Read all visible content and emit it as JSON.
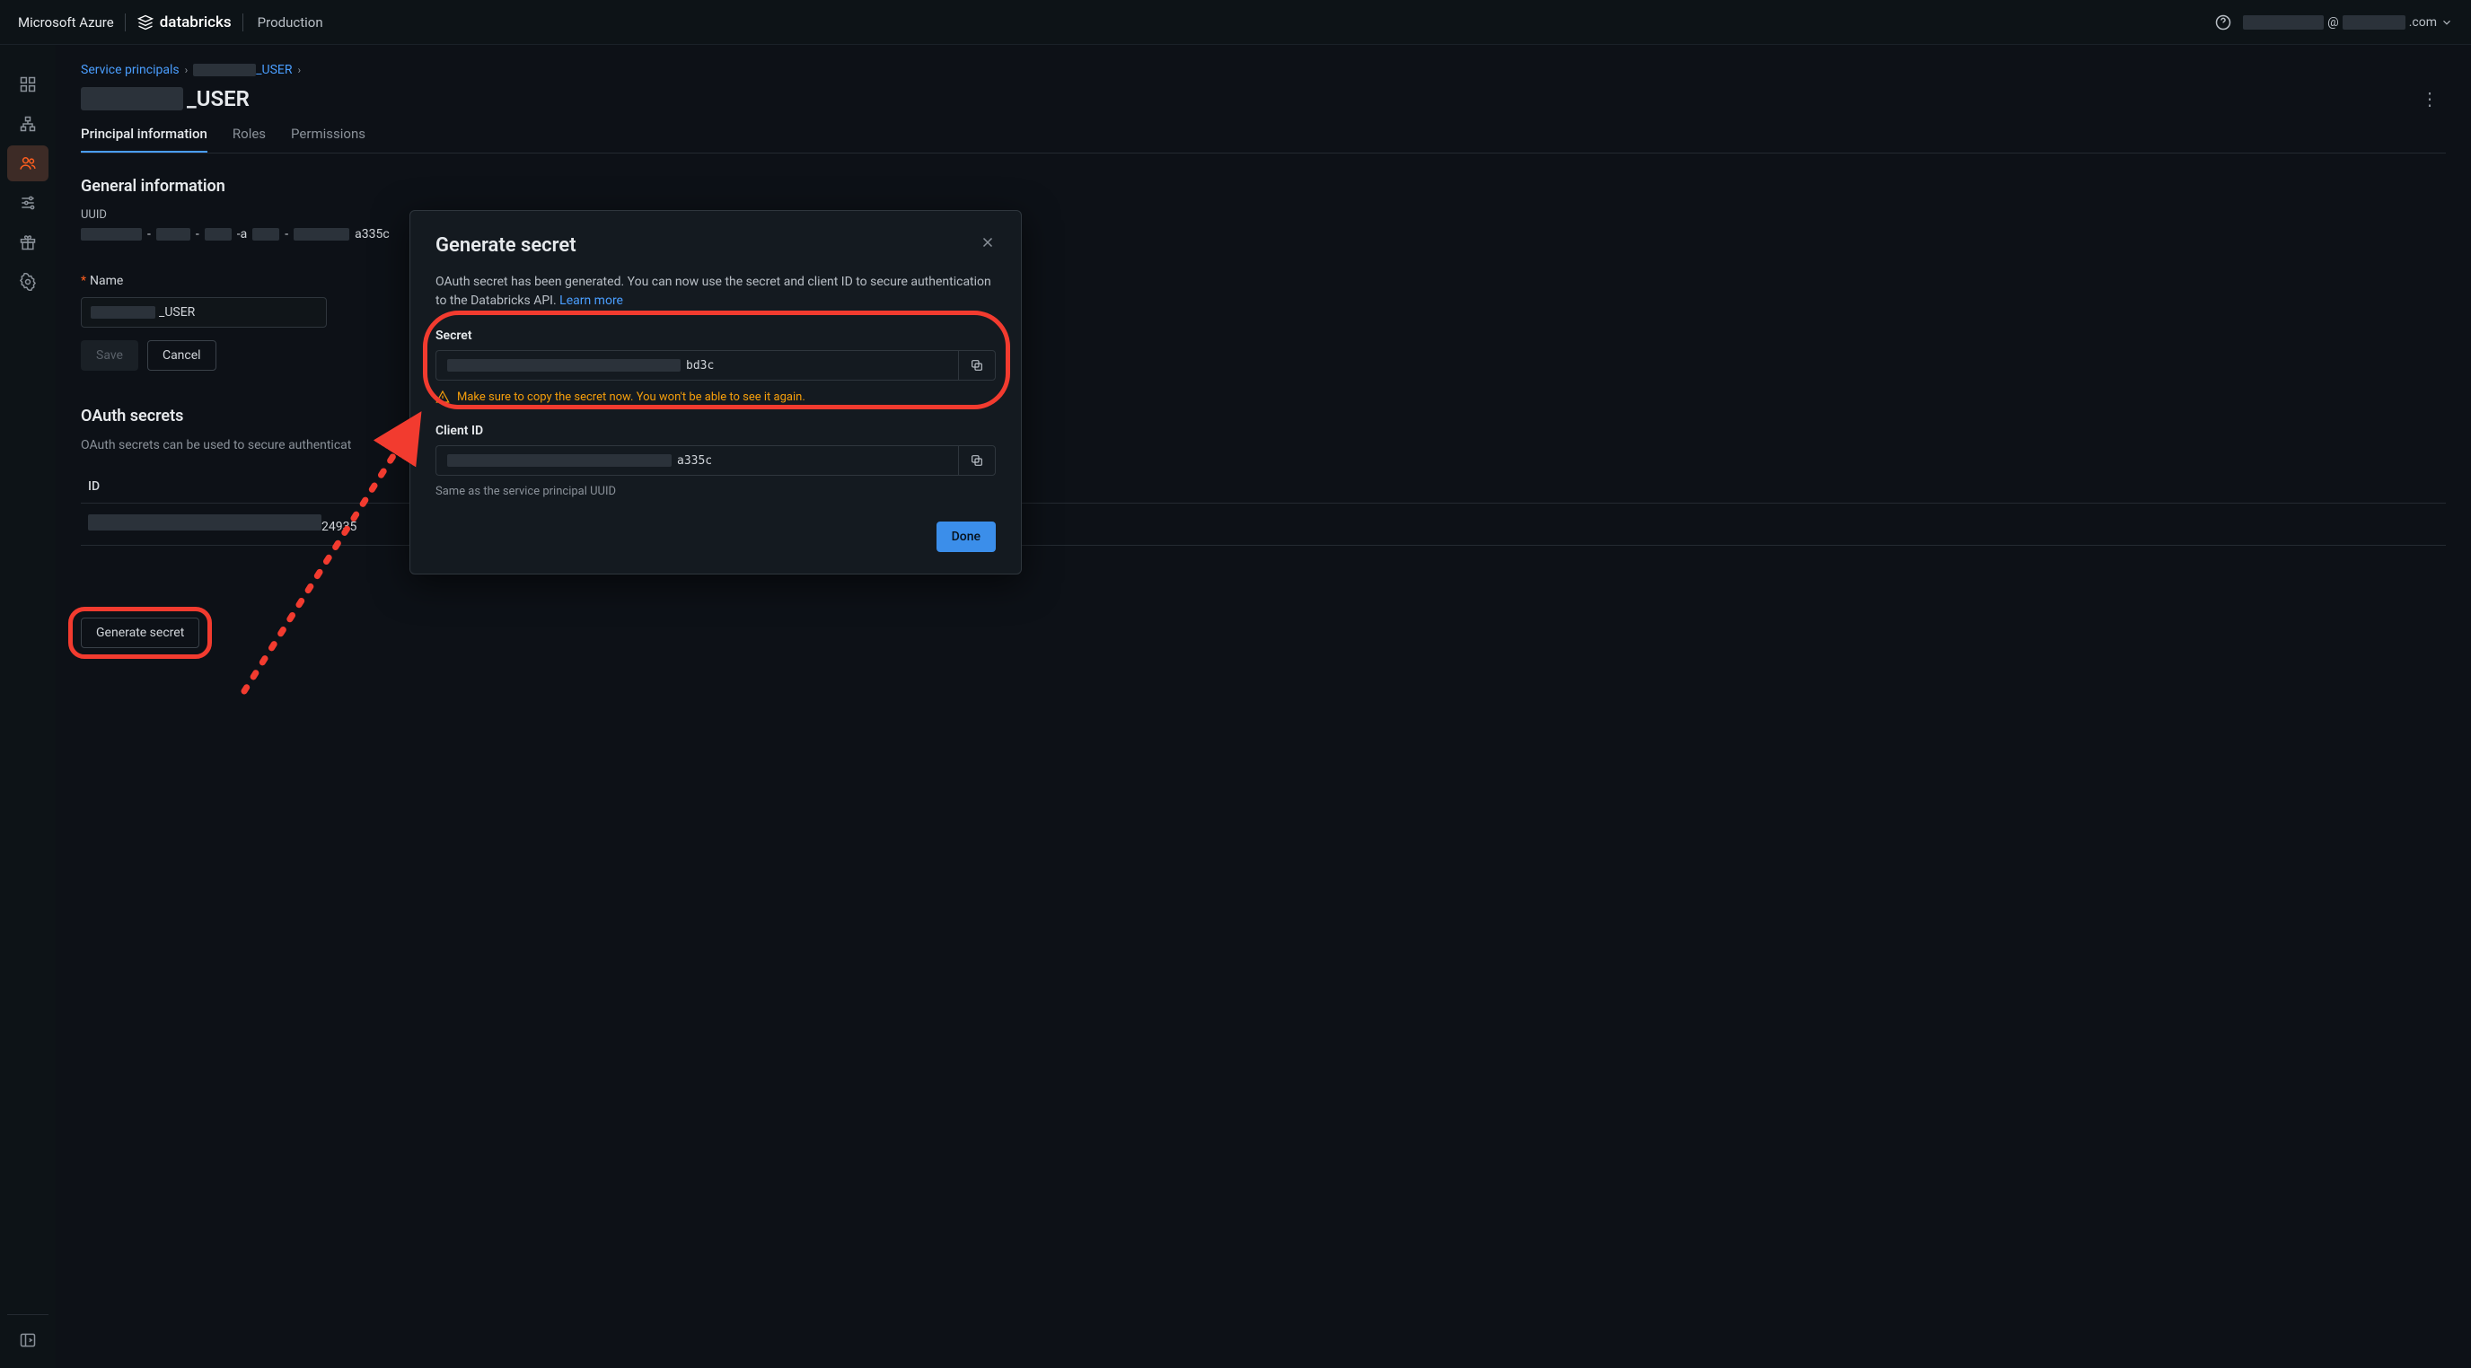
{
  "topbar": {
    "azure": "Microsoft Azure",
    "databricks": "databricks",
    "env": "Production",
    "user_mid": "@",
    "user_end": ".com"
  },
  "breadcrumbs": {
    "root": "Service principals",
    "current_suffix": "_USER"
  },
  "page": {
    "title_suffix": "_USER"
  },
  "tabs": {
    "info": "Principal information",
    "roles": "Roles",
    "perms": "Permissions"
  },
  "general": {
    "heading": "General information",
    "uuid_label": "UUID",
    "uuid_suffix": "a335c",
    "name_label": "Name",
    "name_suffix": "_USER",
    "save": "Save",
    "cancel": "Cancel"
  },
  "oauth": {
    "heading": "OAuth secrets",
    "helper": "OAuth secrets can be used to secure authenticat",
    "col_id": "ID",
    "row1_suffix": "24935",
    "generate": "Generate secret"
  },
  "modal": {
    "title": "Generate secret",
    "desc": "OAuth secret has been generated. You can now use the secret and client ID to secure authentication to the Databricks API. ",
    "learn": "Learn more",
    "secret_label": "Secret",
    "secret_suffix": "bd3c",
    "warn": "Make sure to copy the secret now. You won't be able to see it again.",
    "client_label": "Client ID",
    "client_suffix": "a335c",
    "hint": "Same as the service principal UUID",
    "done": "Done"
  }
}
